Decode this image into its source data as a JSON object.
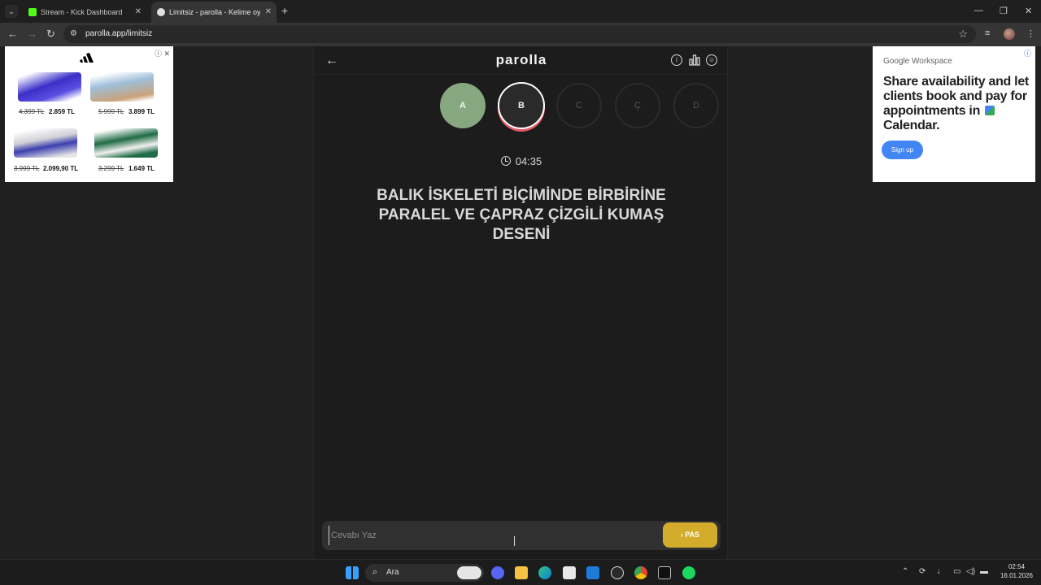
{
  "browser": {
    "tabs": [
      {
        "label": "Stream - Kick Dashboard",
        "active": false
      },
      {
        "label": "Limitsiz - parolla - Kelime oyunu",
        "active": true
      }
    ],
    "url": "parolla.app/limitsiz"
  },
  "ads": {
    "left": {
      "products": [
        {
          "old_price": "4.399 TL",
          "new_price": "2.859 TL"
        },
        {
          "old_price": "5.999 TL",
          "new_price": "3.899 TL"
        },
        {
          "old_price": "3.999 TL",
          "new_price": "2.099,90 TL"
        },
        {
          "old_price": "3.299 TL",
          "new_price": "1.649 TL"
        }
      ]
    },
    "right": {
      "brand": "Google Workspace",
      "headline_part1": "Share availability and let clients book and pay for appointments in",
      "headline_part2": "Calendar.",
      "cta": "Sign up"
    }
  },
  "game": {
    "brand": "parolla",
    "letters": [
      {
        "char": "A",
        "state": "correct"
      },
      {
        "char": "B",
        "state": "current"
      },
      {
        "char": "C",
        "state": "pending"
      },
      {
        "char": "Ç",
        "state": "pending"
      },
      {
        "char": "D",
        "state": "pending"
      }
    ],
    "timer": "04:35",
    "question": "BALIK İSKELETİ BİÇİMİNDE BİRBİRİNE PARALEL VE ÇAPRAZ ÇİZGİLİ KUMAŞ DESENİ",
    "answer_placeholder": "Cevabı Yaz",
    "pass_label": "PAS",
    "colors": {
      "correct": "#86a77f",
      "current_ring": "#e05a62",
      "pass": "#d2ac2a"
    }
  },
  "taskbar": {
    "search_label": "Ara",
    "time": "02:54",
    "date": "16.01.2026"
  }
}
